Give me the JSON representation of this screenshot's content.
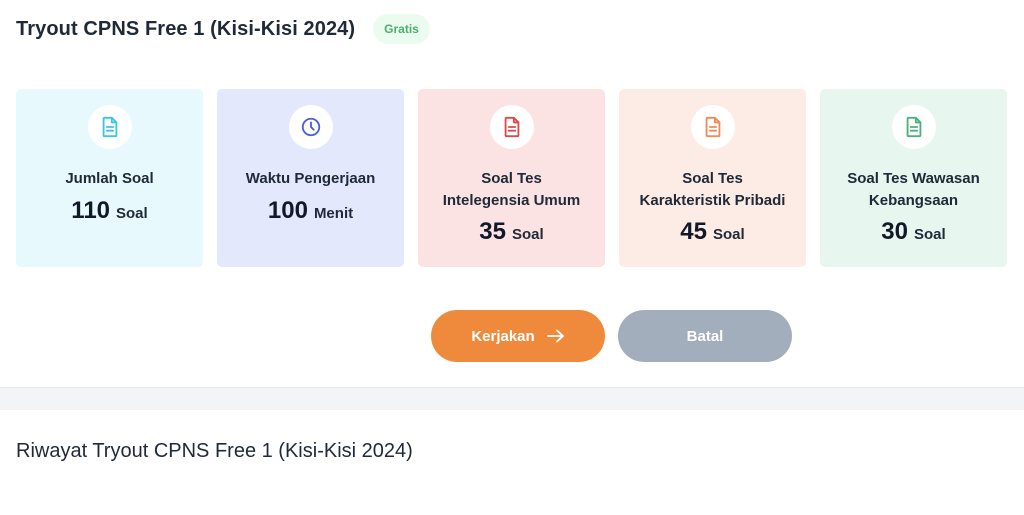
{
  "header": {
    "title": "Tryout CPNS Free 1 (Kisi-Kisi 2024)",
    "badge": "Gratis"
  },
  "cards": [
    {
      "label_line1": "Jumlah Soal",
      "label_line2": "",
      "value": "110",
      "unit": "Soal",
      "icon": "document-icon",
      "bg": "#e8f9fd",
      "accent": "#38c6e3"
    },
    {
      "label_line1": "Waktu Pengerjaan",
      "label_line2": "",
      "value": "100",
      "unit": "Menit",
      "icon": "clock-icon",
      "bg": "#e4e8fd",
      "accent": "#4b5fd6"
    },
    {
      "label_line1": "Soal Tes",
      "label_line2": "Intelegensia Umum",
      "value": "35",
      "unit": "Soal",
      "icon": "document-icon",
      "bg": "#fbe3e3",
      "accent": "#e04848"
    },
    {
      "label_line1": "Soal Tes",
      "label_line2": "Karakteristik Pribadi",
      "value": "45",
      "unit": "Soal",
      "icon": "document-icon",
      "bg": "#fdece6",
      "accent": "#ef8a5a"
    },
    {
      "label_line1": "Soal Tes Wawasan",
      "label_line2": "Kebangsaan",
      "value": "30",
      "unit": "Soal",
      "icon": "document-icon",
      "bg": "#e7f6ee",
      "accent": "#4bb07a"
    }
  ],
  "actions": {
    "start_label": "Kerjakan",
    "cancel_label": "Batal"
  },
  "history": {
    "title": "Riwayat Tryout CPNS Free 1 (Kisi-Kisi 2024)"
  }
}
